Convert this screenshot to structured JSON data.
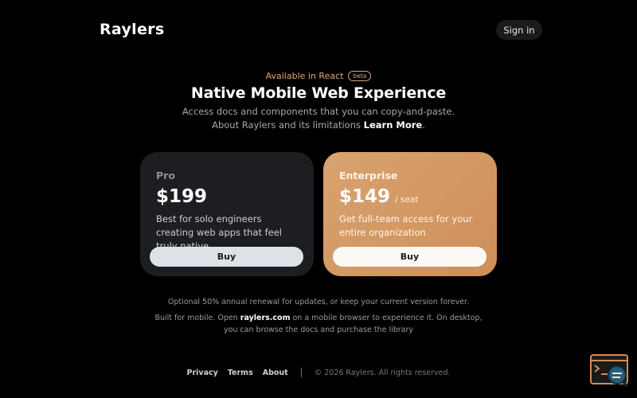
{
  "header": {
    "logo": "Raylers",
    "sign_in": "Sign in"
  },
  "hero": {
    "eyebrow": "Available in React",
    "badge": "beta",
    "title": "Native Mobile Web Experience",
    "subtitle_line1": "Access docs and components that you can copy-and-paste.",
    "subtitle_line2_prefix": "About Raylers and its limitations ",
    "learn_more": "Learn More",
    "subtitle_line2_suffix": "."
  },
  "plans": [
    {
      "name": "Pro",
      "price": "$199",
      "unit": "",
      "description": "Best for solo engineers creating web apps that feel truly native",
      "button": "Buy"
    },
    {
      "name": "Enterprise",
      "price": "$149",
      "unit": "/ seat",
      "description": "Get full-team access for your entire organization",
      "button": "Buy"
    }
  ],
  "notes": {
    "renewal": "Optional 50% annual renewal for updates, or keep your current version forever.",
    "mobile_prefix": "Built for mobile. Open ",
    "mobile_domain": "raylers.com",
    "mobile_suffix": " on a mobile browser to experience it. On desktop,",
    "mobile_line2": "you can browse the docs and purchase the library"
  },
  "footer": {
    "links": [
      "Privacy",
      "Terms",
      "About"
    ],
    "copyright": "© 2026 Raylers. All rights reserved."
  },
  "widget": {
    "icon": "terminal-search-icon"
  },
  "colors": {
    "background": "#000000",
    "accent": "#d7a678",
    "enterprise_card": "#d39a66",
    "pro_card": "#1d1e21"
  }
}
